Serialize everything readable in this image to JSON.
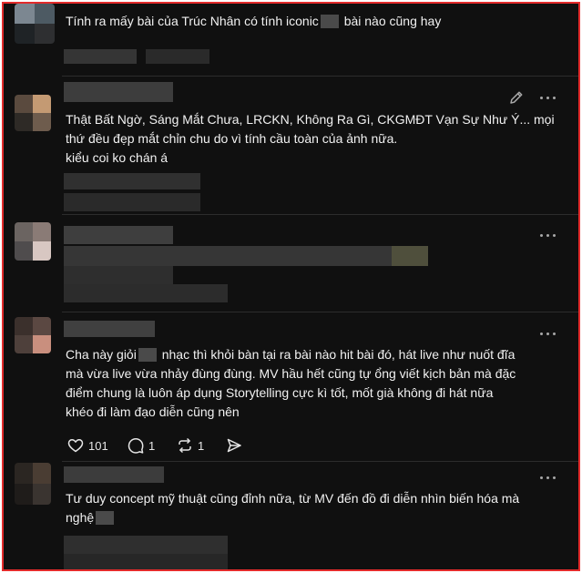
{
  "comments": [
    {
      "text_before": "Tính ra mấy bài của Trúc Nhân có tính iconic",
      "text_after": " bài nào cũng hay"
    },
    {
      "line1": "Thật Bất Ngờ, Sáng Mắt Chưa, LRCKN, Không Ra Gì, CKGMĐT Vạn Sự Như Ý... mọi",
      "line2": "thứ đều đẹp mắt chỉn chu do vì tính cầu toàn của ảnh nữa.",
      "line3": "kiểu coi ko chán á"
    },
    {},
    {
      "text_before": "Cha này giỏi",
      "text_after": " nhạc thì khỏi bàn tại ra bài nào hit bài đó, hát live như nuốt đĩa",
      "line2": "mà vừa live vừa nhảy đùng đùng. MV hầu hết cũng tự ổng viết kịch bản mà đặc",
      "line3": "điểm chung là luôn áp dụng Storytelling cực kì tốt, mốt già không đi hát nữa",
      "line4": "khéo đi làm đạo diễn cũng nên",
      "likes": "101",
      "replies": "1",
      "reposts": "1"
    },
    {
      "line1": "Tư duy concept mỹ thuật cũng đỉnh nữa, từ MV đến đồ đi diễn nhìn biến hóa mà",
      "line2_before": "nghệ"
    }
  ],
  "colors": {
    "frame_border": "#e32b2b",
    "background": "#101010",
    "text": "#f1f1f1",
    "icon": "#a8a8a8"
  },
  "icons": [
    "more-icon",
    "edit-pencil-icon",
    "heart-icon",
    "comment-icon",
    "repost-icon",
    "share-icon"
  ]
}
